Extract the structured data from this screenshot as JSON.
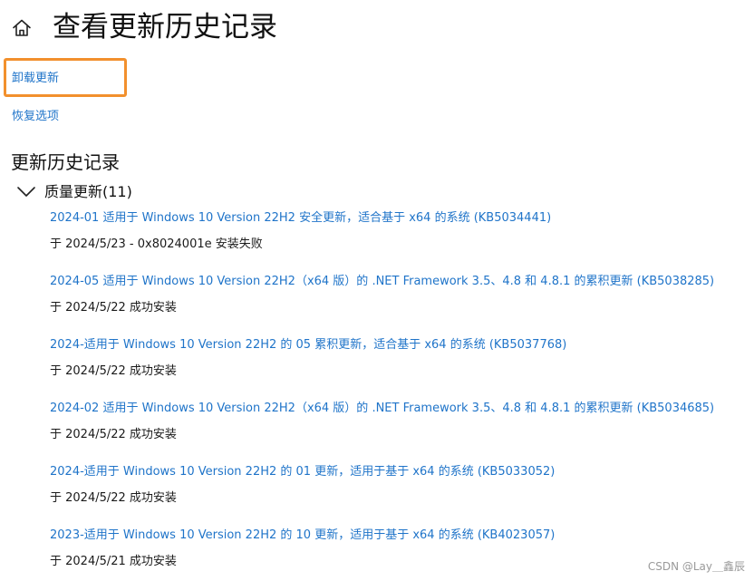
{
  "header": {
    "title": "查看更新历史记录",
    "home_icon": "home-icon"
  },
  "links": {
    "uninstall": "卸载更新",
    "recovery": "恢复选项"
  },
  "highlight_color": "#f2902d",
  "link_color": "#1f74c9",
  "history": {
    "title": "更新历史记录",
    "group": {
      "label": "质量更新(11)",
      "expanded": true,
      "icon": "chevron-down-icon"
    },
    "items": [
      {
        "title": "2024-01 适用于 Windows 10 Version 22H2 安全更新，适合基于 x64 的系统 (KB5034441)",
        "status": "于 2024/5/23 - 0x8024001e 安装失败"
      },
      {
        "title": "2024-05 适用于 Windows 10 Version 22H2（x64 版）的 .NET Framework 3.5、4.8 和 4.8.1 的累积更新 (KB5038285)",
        "status": "于 2024/5/22 成功安装"
      },
      {
        "title": "2024-适用于 Windows 10 Version 22H2 的 05 累积更新，适合基于 x64 的系统 (KB5037768)",
        "status": "于 2024/5/22 成功安装"
      },
      {
        "title": "2024-02 适用于 Windows 10 Version 22H2（x64 版）的 .NET Framework 3.5、4.8 和 4.8.1 的累积更新 (KB5034685)",
        "status": "于 2024/5/22 成功安装"
      },
      {
        "title": "2024-适用于 Windows 10 Version 22H2 的 01 更新，适用于基于 x64 的系统 (KB5033052)",
        "status": "于 2024/5/22 成功安装"
      },
      {
        "title": "2023-适用于 Windows 10 Version 22H2 的 10 更新，适用于基于 x64 的系统 (KB4023057)",
        "status": "于 2024/5/21 成功安装"
      }
    ]
  },
  "watermark": "CSDN @Lay＿鑫辰"
}
